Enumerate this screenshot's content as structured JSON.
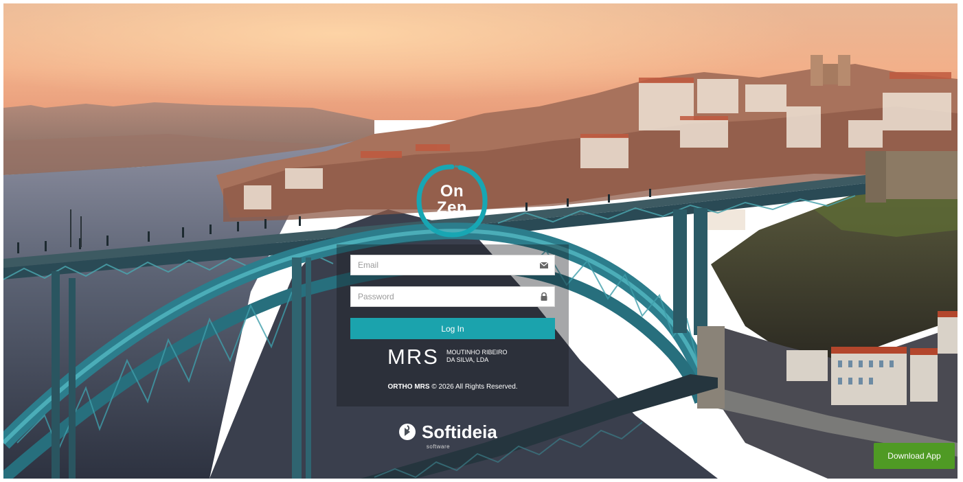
{
  "brand": {
    "logo_line1": "On",
    "logo_line2": "Zen",
    "accent_color": "#1ba3ad"
  },
  "login": {
    "email_placeholder": "Email",
    "email_icon": "envelope-icon",
    "password_placeholder": "Password",
    "password_icon": "lock-icon",
    "login_label": "Log In"
  },
  "partner": {
    "mrs_mark": "MRS",
    "mrs_line1": "MOUTINHO RIBEIRO",
    "mrs_line2": "DA SILVA, LDA"
  },
  "footer": {
    "company": "ORTHO MRS",
    "copyright_text": "© 2026 All Rights Reserved."
  },
  "vendor": {
    "name": "Softideia",
    "subtitle": "software",
    "icon": "softideia-logo-icon"
  },
  "download": {
    "label": "Download App",
    "color": "#4f9a24"
  }
}
